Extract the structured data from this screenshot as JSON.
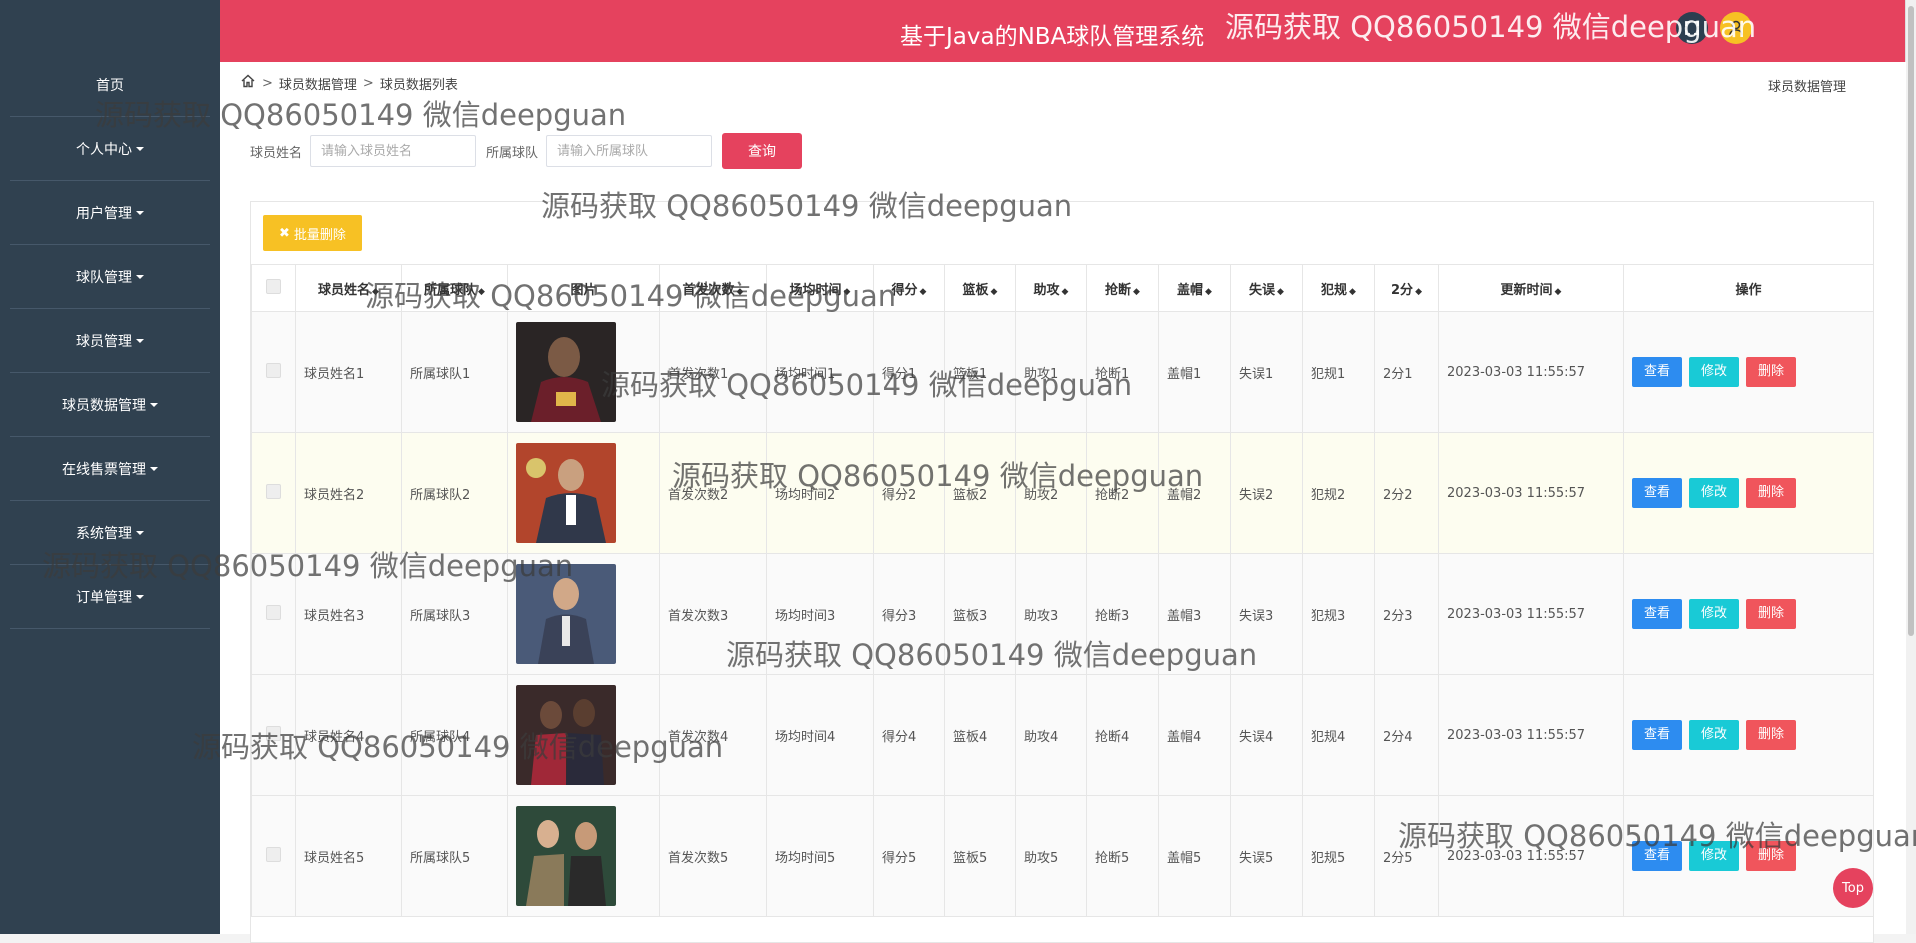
{
  "app_title": "基于Java的NBA球队管理系统",
  "sidebar": {
    "items": [
      {
        "label": "首页",
        "caret": false
      },
      {
        "label": "个人中心",
        "caret": true
      },
      {
        "label": "用户管理",
        "caret": true
      },
      {
        "label": "球队管理",
        "caret": true
      },
      {
        "label": "球员管理",
        "caret": true
      },
      {
        "label": "球员数据管理",
        "caret": true
      },
      {
        "label": "在线售票管理",
        "caret": true
      },
      {
        "label": "系统管理",
        "caret": true
      },
      {
        "label": "订单管理",
        "caret": true
      }
    ]
  },
  "breadcrumb": [
    "球员数据管理",
    "球员数据列表"
  ],
  "page_label": "球员数据管理",
  "search": {
    "name_label": "球员姓名",
    "name_placeholder": "请输入球员姓名",
    "team_label": "所属球队",
    "team_placeholder": "请输入所属球队",
    "query_button": "查询"
  },
  "batch_delete": "批量删除",
  "table": {
    "headers": [
      "球员姓名",
      "所属球队",
      "图片",
      "首发次数",
      "场均时间",
      "得分",
      "篮板",
      "助攻",
      "抢断",
      "盖帽",
      "失误",
      "犯规",
      "2分",
      "更新时间",
      "操作"
    ],
    "rows": [
      {
        "name": "球员姓名1",
        "team": "所属球队1",
        "starts": "首发次数1",
        "minutes": "场均时间1",
        "points": "得分1",
        "rebounds": "篮板1",
        "assists": "助攻1",
        "steals": "抢断1",
        "blocks": "盖帽1",
        "turnovers": "失误1",
        "fouls": "犯规1",
        "two_pt": "2分1",
        "updated": "2023-03-03 11:55:57"
      },
      {
        "name": "球员姓名2",
        "team": "所属球队2",
        "starts": "首发次数2",
        "minutes": "场均时间2",
        "points": "得分2",
        "rebounds": "篮板2",
        "assists": "助攻2",
        "steals": "抢断2",
        "blocks": "盖帽2",
        "turnovers": "失误2",
        "fouls": "犯规2",
        "two_pt": "2分2",
        "updated": "2023-03-03 11:55:57"
      },
      {
        "name": "球员姓名3",
        "team": "所属球队3",
        "starts": "首发次数3",
        "minutes": "场均时间3",
        "points": "得分3",
        "rebounds": "篮板3",
        "assists": "助攻3",
        "steals": "抢断3",
        "blocks": "盖帽3",
        "turnovers": "失误3",
        "fouls": "犯规3",
        "two_pt": "2分3",
        "updated": "2023-03-03 11:55:57"
      },
      {
        "name": "球员姓名4",
        "team": "所属球队4",
        "starts": "首发次数4",
        "minutes": "场均时间4",
        "points": "得分4",
        "rebounds": "篮板4",
        "assists": "助攻4",
        "steals": "抢断4",
        "blocks": "盖帽4",
        "turnovers": "失误4",
        "fouls": "犯规4",
        "two_pt": "2分4",
        "updated": "2023-03-03 11:55:57"
      },
      {
        "name": "球员姓名5",
        "team": "所属球队5",
        "starts": "首发次数5",
        "minutes": "场均时间5",
        "points": "得分5",
        "rebounds": "篮板5",
        "assists": "助攻5",
        "steals": "抢断5",
        "blocks": "盖帽5",
        "turnovers": "失误5",
        "fouls": "犯规5",
        "two_pt": "2分5",
        "updated": "2023-03-03 11:55:57"
      }
    ],
    "actions": {
      "view": "查看",
      "edit": "修改",
      "delete": "删除"
    }
  },
  "top_button": "Top",
  "watermark": "源码获取 QQ86050149 微信deepguan",
  "colors": {
    "header": "#e5425e",
    "sidebar": "#304150",
    "view": "#2d8cf0",
    "edit": "#19cad6",
    "delete": "#f0555c",
    "batch": "#f7c124"
  }
}
